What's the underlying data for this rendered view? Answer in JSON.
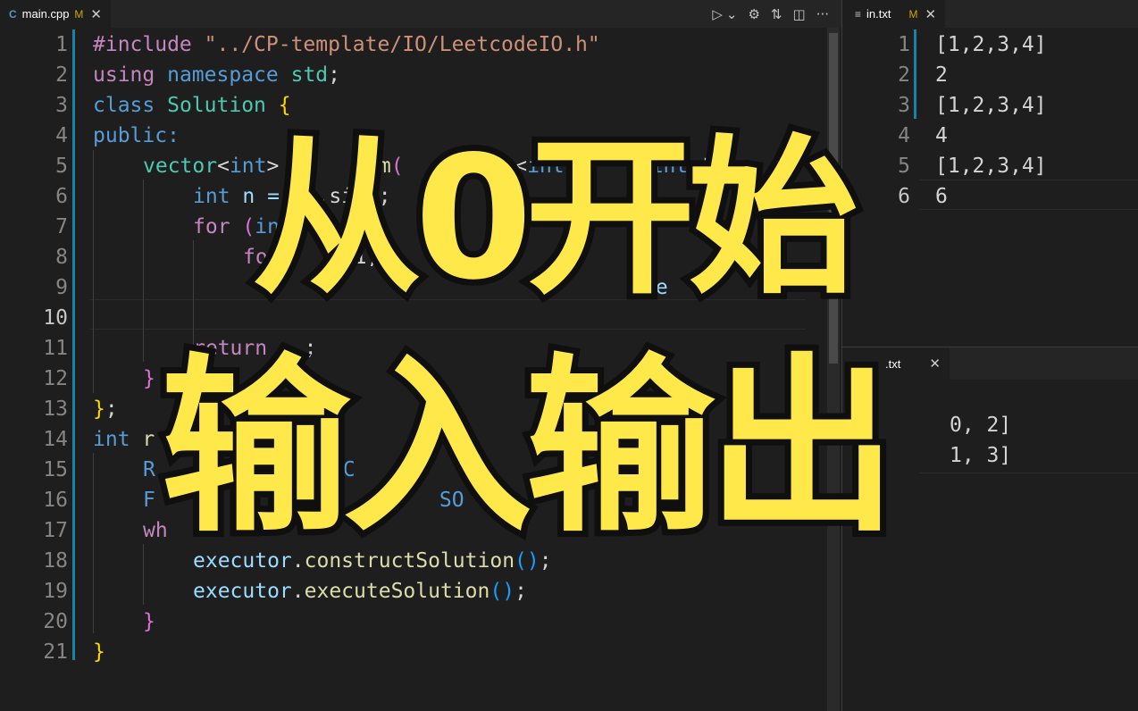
{
  "left_pane": {
    "tab": {
      "icon": "cpp-file-icon",
      "glyph": "C",
      "name": "main.cpp",
      "status": "M",
      "close": "✕"
    },
    "actions": [
      {
        "name": "run-icon",
        "glyph": "▷"
      },
      {
        "name": "run-dropdown-icon",
        "glyph": "⌄"
      },
      {
        "name": "settings-icon",
        "glyph": "⚙"
      },
      {
        "name": "compare-changes-icon",
        "glyph": "⇅"
      },
      {
        "name": "split-editor-icon",
        "glyph": "◫"
      },
      {
        "name": "more-actions-icon",
        "glyph": "···"
      }
    ],
    "line_numbers": [
      "1",
      "2",
      "3",
      "4",
      "5",
      "6",
      "7",
      "8",
      "9",
      "10",
      "11",
      "12",
      "13",
      "14",
      "15",
      "16",
      "17",
      "18",
      "19",
      "20",
      "21"
    ],
    "active_line": "10",
    "code": {
      "l1": {
        "directive": "#include",
        "path": "\"../CP-template/IO/LeetcodeIO.h\""
      },
      "l2": {
        "using": "using",
        "ns": "namespace",
        "std": "std",
        "semi": ";"
      },
      "l3": {
        "class": "class",
        "name": "Solution",
        "brace": "{"
      },
      "l4": {
        "public": "public:"
      },
      "l5": {
        "type1": "vector",
        "lt": "<",
        "int": "int",
        "gt": ">",
        "gap": " ",
        "fn_tail": "Sum",
        "paren": "(",
        "mid": "       or<",
        "int2": "int",
        "rest": "       ",
        "int3": "int",
        "tail": " t"
      },
      "l6": {
        "int": "int",
        "rest": " n = ",
        "tail": "  .si  ;"
      },
      "l7": {
        "for": "for",
        "paren": " (",
        "in": "in",
        "tail": "       n;"
      },
      "l8": {
        "for": "fo",
        "tail": "     + 1;"
      },
      "l9": {
        "tail": "re"
      },
      "l11": {
        "ret": "return",
        "tail": "   ;"
      },
      "l12": {
        "brace": "}"
      },
      "l13": {
        "brace": "}",
        "semi": ";"
      },
      "l14": {
        "int": "int",
        "rest": " r"
      },
      "l15": {
        "a": "R",
        "b": "TC"
      },
      "l16": {
        "a": "F",
        "b": "SO"
      },
      "l17": {
        "a": "wh"
      },
      "l18": {
        "obj": "executor",
        "dot": ".",
        "method": "constructSolution",
        "call": "()",
        "semi": ";"
      },
      "l19": {
        "obj": "executor",
        "dot": ".",
        "method": "executeSolution",
        "call": "()",
        "semi": ";"
      },
      "l20": {
        "brace": "}"
      },
      "l21": {
        "brace": "}"
      }
    }
  },
  "right_top": {
    "tab": {
      "icon": "text-file-icon",
      "glyph": "≡",
      "name": "in.txt",
      "status": "M",
      "close": "✕"
    },
    "line_numbers": [
      "1",
      "2",
      "3",
      "4",
      "5",
      "6"
    ],
    "lines": [
      "[1,2,3,4]",
      "2",
      "[1,2,3,4]",
      "4",
      "[1,2,3,4]",
      "6"
    ]
  },
  "right_bottom": {
    "tab": {
      "name": ".txt",
      "close": "✕"
    },
    "lines": [
      "0, 2]",
      "1, 3]"
    ]
  },
  "title_overlay": {
    "line1": "从0开始",
    "line2": "输入输出"
  }
}
